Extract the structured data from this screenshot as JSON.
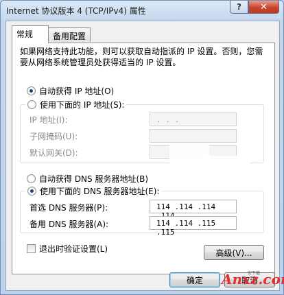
{
  "window": {
    "title": "Internet 协议版本 4 (TCP/IPv4) 属性",
    "help_label": "?",
    "close_label": "✕"
  },
  "tabs": [
    {
      "label": "常规",
      "active": true
    },
    {
      "label": "备用配置",
      "active": false
    }
  ],
  "description": "如果网络支持此功能，则可以获取自动指派的 IP 设置。否则，您需要从网络系统管理员处获得适当的 IP 设置。",
  "ip_section": {
    "auto_label": "自动获得 IP 地址(O)",
    "auto_checked": true,
    "manual_label": "使用下面的 IP 地址(S):",
    "manual_checked": false,
    "fields": [
      {
        "label": "IP 地址(I):",
        "value": " .  .  . "
      },
      {
        "label": "子网掩码(U):",
        "value": ""
      },
      {
        "label": "默认网关(D):",
        "value": ""
      }
    ]
  },
  "dns_section": {
    "auto_label": "自动获得 DNS 服务器地址(B)",
    "auto_checked": false,
    "manual_label": "使用下面的 DNS 服务器地址(E):",
    "manual_checked": true,
    "fields": [
      {
        "label": "首选 DNS 服务器(P):",
        "value": "114 .114 .114 .114"
      },
      {
        "label": "备用 DNS 服务器(A):",
        "value": "114 .114 .115 .115"
      }
    ]
  },
  "validate_label": "退出时验证设置(L)",
  "validate_checked": false,
  "advanced_button": "高级(V)...",
  "ok_button": "确定",
  "cancel_button": "取消",
  "watermark": {
    "text": "Anxz.com",
    "sub": "安下载"
  },
  "colors": {
    "accent": "#3c7fb1",
    "close": "#c9452c",
    "watermark": "#e03030"
  }
}
